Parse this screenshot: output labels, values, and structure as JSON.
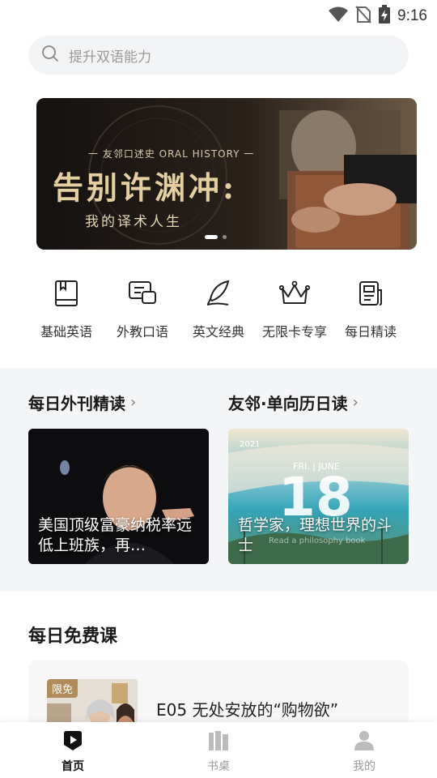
{
  "status_bar": {
    "time": "9:16"
  },
  "search": {
    "placeholder": "提升双语能力"
  },
  "banner": {
    "kicker": "一 友邻口述史 ORAL HISTORY 一",
    "headline": "告别许渊冲:",
    "subline": "我的译术人生",
    "page_count": 2,
    "active_page": 1
  },
  "nav": {
    "items": [
      {
        "label": "基础英语",
        "icon": "book-icon"
      },
      {
        "label": "外教口语",
        "icon": "chat-icon"
      },
      {
        "label": "英文经典",
        "icon": "quill-icon"
      },
      {
        "label": "无限卡专享",
        "icon": "crown-icon"
      },
      {
        "label": "每日精读",
        "icon": "document-icon"
      }
    ]
  },
  "sections": {
    "daily_journal": {
      "title": "每日外刊精读",
      "card_text": "美国顶级富豪纳税率远低上班族，再…"
    },
    "calendar": {
      "title": "友邻·单向历日读",
      "card_text": "哲学家，理想世界的斗士",
      "card_year": "2021",
      "card_date_line": "FRI. | JUNE",
      "card_day": "18",
      "card_overlay": "Read a philosophy book"
    }
  },
  "free_course": {
    "title": "每日免费课",
    "badge": "限免",
    "course_title": "E05 无处安放的“购物欲”"
  },
  "tabbar": {
    "tabs": [
      {
        "label": "首页",
        "icon": "play-home-icon",
        "active": true
      },
      {
        "label": "书桌",
        "icon": "bookshelf-icon",
        "active": false
      },
      {
        "label": "我的",
        "icon": "profile-icon",
        "active": false
      }
    ]
  },
  "colors": {
    "accent": "#b08c5c",
    "section_bg": "#f4f5f7",
    "search_bg": "#f3f4f6"
  }
}
